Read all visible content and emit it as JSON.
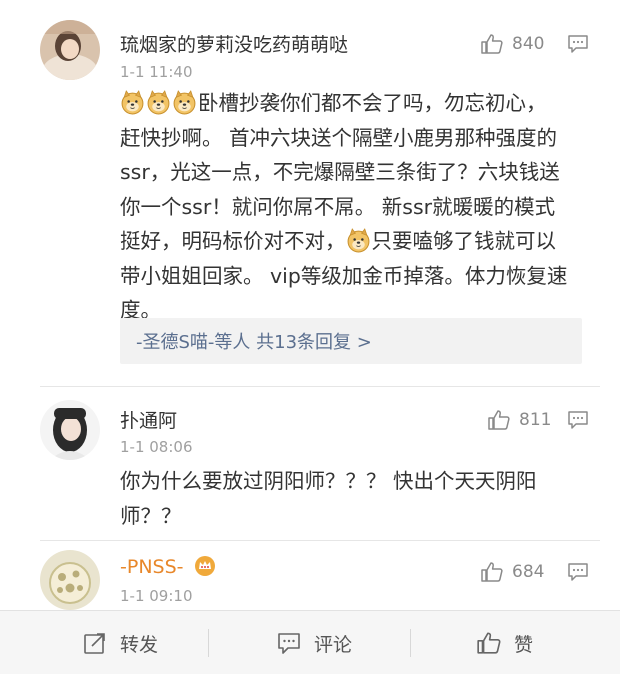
{
  "comments": [
    {
      "username": "琉烟家的萝莉没吃药萌萌哒",
      "time": "1-1 11:40",
      "likes": "840",
      "body_line1": "卧槽抄袭你们都不会了吗，勿忘初心，",
      "body_lines_mid": [
        "赶快抄啊。 首冲六块送个隔壁小鹿男那种强度的",
        "ssr，光这一点，不完爆隔壁三条街了？六块钱送",
        "你一个ssr！就问你屌不屌。 新ssr就暖暖的模式"
      ],
      "body_line5a": "挺好，明码标价对不对，",
      "body_line5b": "只要嗑够了钱就可以",
      "body_lines_end": [
        "带小姐姐回家。 vip等级加金币掉落。体力恢复速",
        "度。"
      ],
      "replies_summary": "-圣德S喵-等人  共13条回复 >"
    },
    {
      "username": "扑通阿",
      "time": "1-1 08:06",
      "likes": "811",
      "body_lines": [
        "你为什么要放过阴阳师？？？ 快出个天天阴阳",
        "师？？"
      ]
    },
    {
      "username": "-PNSS-",
      "time": "1-1 09:10",
      "likes": "684"
    }
  ],
  "bottom_bar": {
    "repost_label": "转发",
    "comment_label": "评论",
    "like_label": "赞"
  },
  "colors": {
    "username_orange": "#e8872a",
    "link_blue": "#5b6f8f",
    "muted_gray": "#a0a0a0"
  },
  "icons": [
    "like-icon",
    "reply-icon",
    "doge-emoji",
    "crown-badge-icon",
    "repost-icon",
    "comment-icon"
  ]
}
